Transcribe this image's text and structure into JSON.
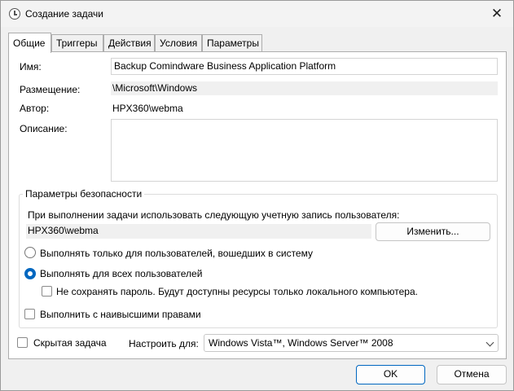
{
  "window": {
    "title": "Создание задачи",
    "close_glyph": "✕"
  },
  "tabs": [
    {
      "label": "Общие",
      "active": true
    },
    {
      "label": "Триггеры"
    },
    {
      "label": "Действия"
    },
    {
      "label": "Условия"
    },
    {
      "label": "Параметры"
    }
  ],
  "general": {
    "name_label": "Имя:",
    "name_value": "Backup Comindware Business Application Platform",
    "location_label": "Размещение:",
    "location_value": "\\Microsoft\\Windows",
    "author_label": "Автор:",
    "author_value": "HPX360\\webma",
    "description_label": "Описание:",
    "description_value": ""
  },
  "security": {
    "group_title": "Параметры безопасности",
    "account_prompt": "При выполнении задачи использовать следующую учетную запись пользователя:",
    "account_value": "HPX360\\webma",
    "change_button": "Изменить...",
    "radio_logged_on": "Выполнять только для пользователей, вошедших в систему",
    "radio_all_users": "Выполнять для всех пользователей",
    "checkbox_no_password": "Не сохранять пароль. Будут доступны ресурсы только локального компьютера.",
    "checkbox_highest": "Выполнить с наивысшими правами"
  },
  "bottom": {
    "hidden_label": "Скрытая задача",
    "configure_label": "Настроить для:",
    "configure_value": "Windows Vista™, Windows Server™ 2008"
  },
  "buttons": {
    "ok": "OK",
    "cancel": "Отмена"
  }
}
